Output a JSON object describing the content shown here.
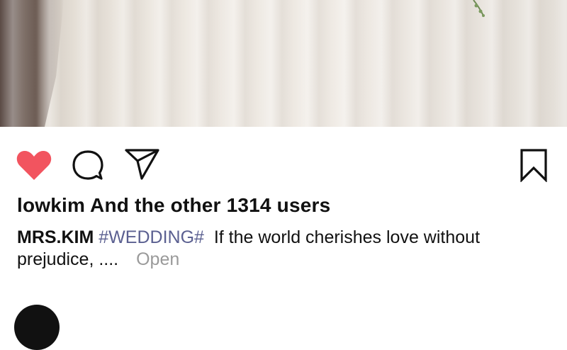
{
  "post": {
    "image_description_icon": "wedding-dress-photo",
    "actions": {
      "like_icon": "heart-filled-icon",
      "like_color": "#f2545f",
      "comment_icon": "comment-bubble-icon",
      "share_icon": "send-plane-icon",
      "save_icon": "bookmark-icon"
    },
    "likes_text": "lowkim And the other 1314 users",
    "caption": {
      "author": "MRS.KIM",
      "hashtag": "#WEDDING#",
      "text": "If the world cherishes love without prejudice, ....",
      "more_label": "Open"
    }
  }
}
